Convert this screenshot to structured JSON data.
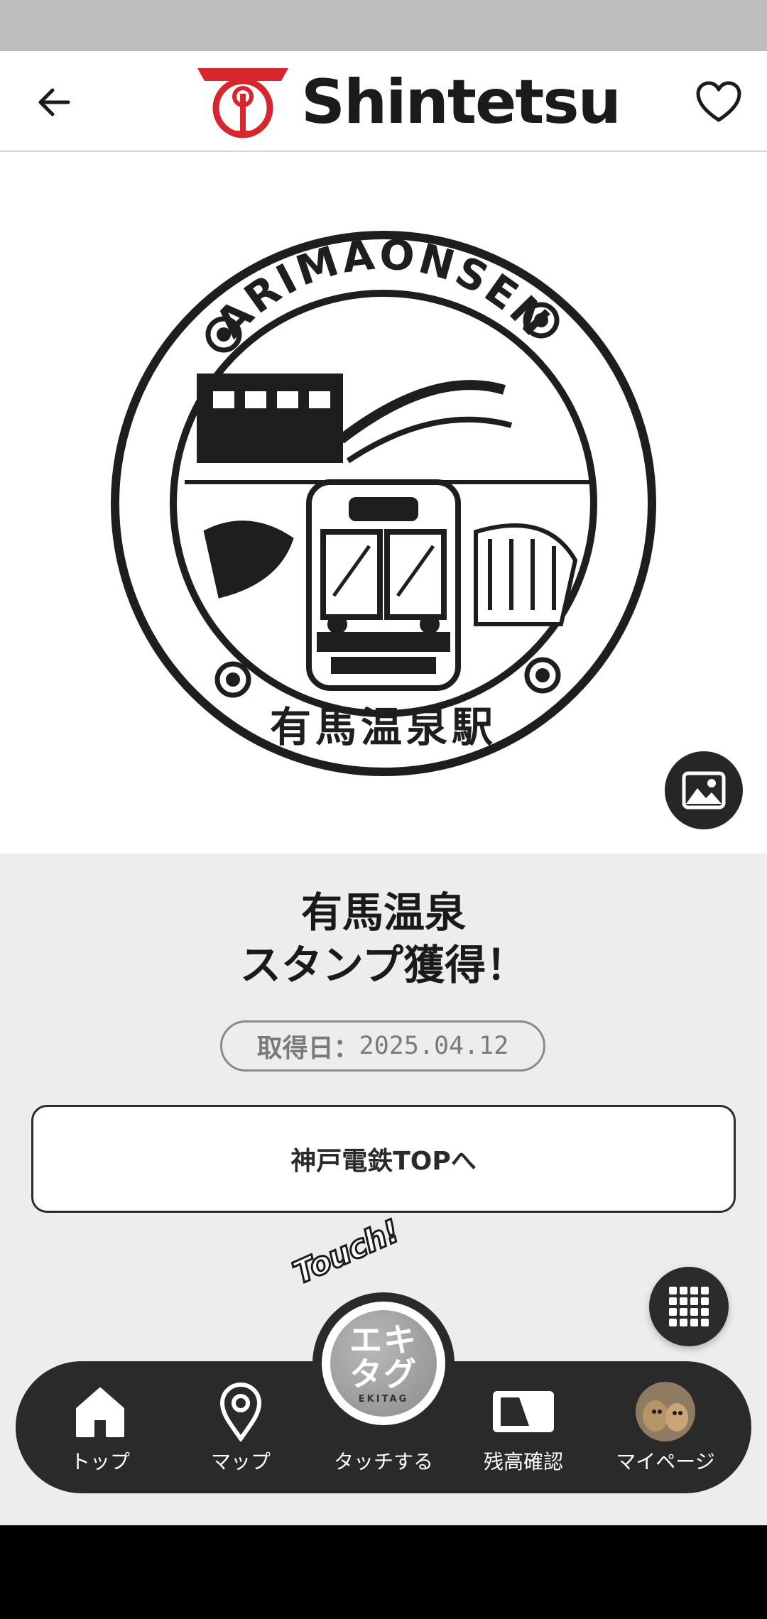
{
  "header": {
    "logo_text": "Shintetsu",
    "back_icon": "arrow-left-icon",
    "favorite_icon": "heart-outline-icon"
  },
  "stamp": {
    "ring_text": "ARIMAONSEN",
    "station_kanji": "有馬温泉駅",
    "image_button_icon": "image-icon"
  },
  "result": {
    "title_line1": "有馬温泉",
    "title_line2": "スタンプ獲得！",
    "date_label": "取得日：",
    "date_value": "2025.04.12",
    "top_button_label": "神戸電鉄TOPへ"
  },
  "touch": {
    "script_text": "Touch!",
    "kana_line1": "エキ",
    "kana_line2": "タグ",
    "sub_text": "EKITAG"
  },
  "nav": {
    "items": [
      {
        "label": "トップ",
        "icon": "home-icon"
      },
      {
        "label": "マップ",
        "icon": "map-pin-icon"
      },
      {
        "label": "タッチする",
        "icon": "touch-ekitag-icon"
      },
      {
        "label": "残高確認",
        "icon": "card-icon"
      },
      {
        "label": "マイページ",
        "icon": "avatar-icon"
      }
    ]
  },
  "colors": {
    "brand_red": "#d7262e",
    "dark": "#2a2a2a",
    "background": "#ededed"
  }
}
